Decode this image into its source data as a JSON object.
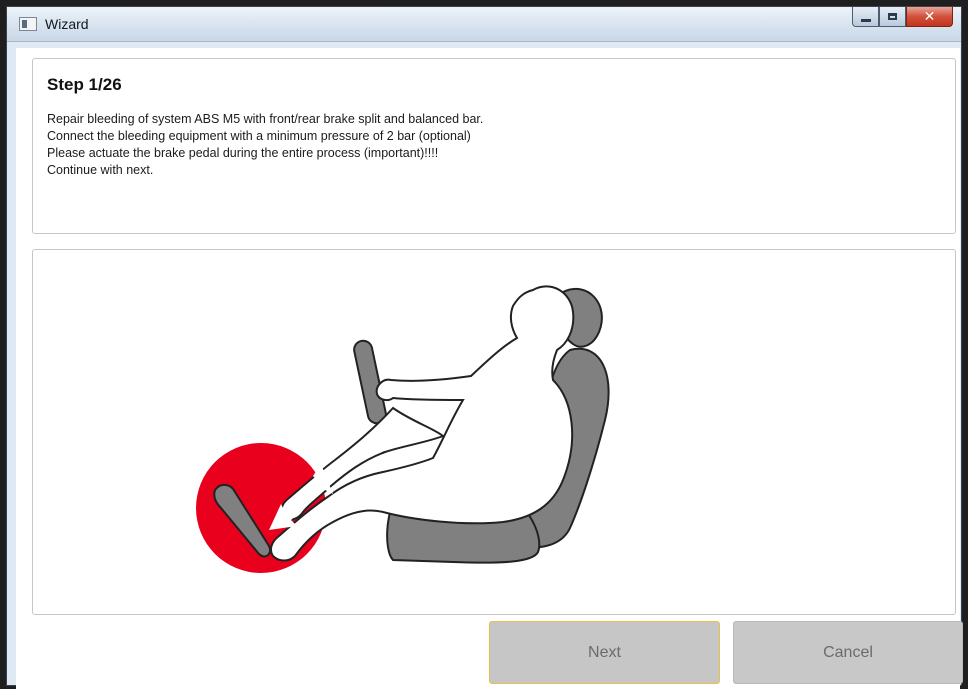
{
  "window": {
    "title": "Wizard",
    "controls": {
      "minimize": "minimize",
      "maximize": "maximize",
      "close": "close"
    }
  },
  "step": {
    "title": "Step 1/26",
    "lines": [
      "Repair bleeding of system ABS M5  with front/rear brake split and balanced bar.",
      "Connect the bleeding equipment with a minimum pressure of 2 bar (optional)",
      "Please actuate the brake pedal during the entire process (important)!!!!",
      "Continue with next."
    ]
  },
  "illustration": {
    "subject": "driver pressing brake pedal",
    "accent_color": "#e8001c",
    "seat_color": "#808080"
  },
  "buttons": {
    "next_label": "Next",
    "cancel_label": "Cancel"
  }
}
